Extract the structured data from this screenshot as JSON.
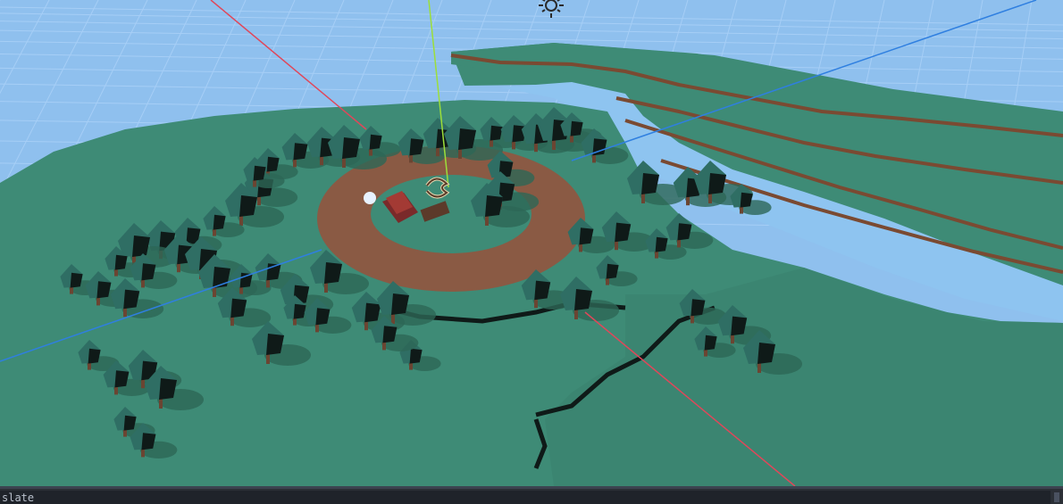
{
  "viewport": {
    "sky_color": "#8fc0ee",
    "grid_color": "#a9d0f7",
    "ground_color": "#3e8b76",
    "path_color": "#8a5a44",
    "tree_foliage_color": "#2f6e64",
    "tree_shadow_color": "#0f1a18",
    "axis_x_color": "#e0475a",
    "axis_y_color": "#9cde3a",
    "axis_z_color": "#2f7fe0",
    "water_color": "#8ec4f0"
  },
  "gizmos": {
    "sun": "sun-icon",
    "spawn_marker": "spawn-marker"
  },
  "output_panel": {
    "text": "slate"
  }
}
